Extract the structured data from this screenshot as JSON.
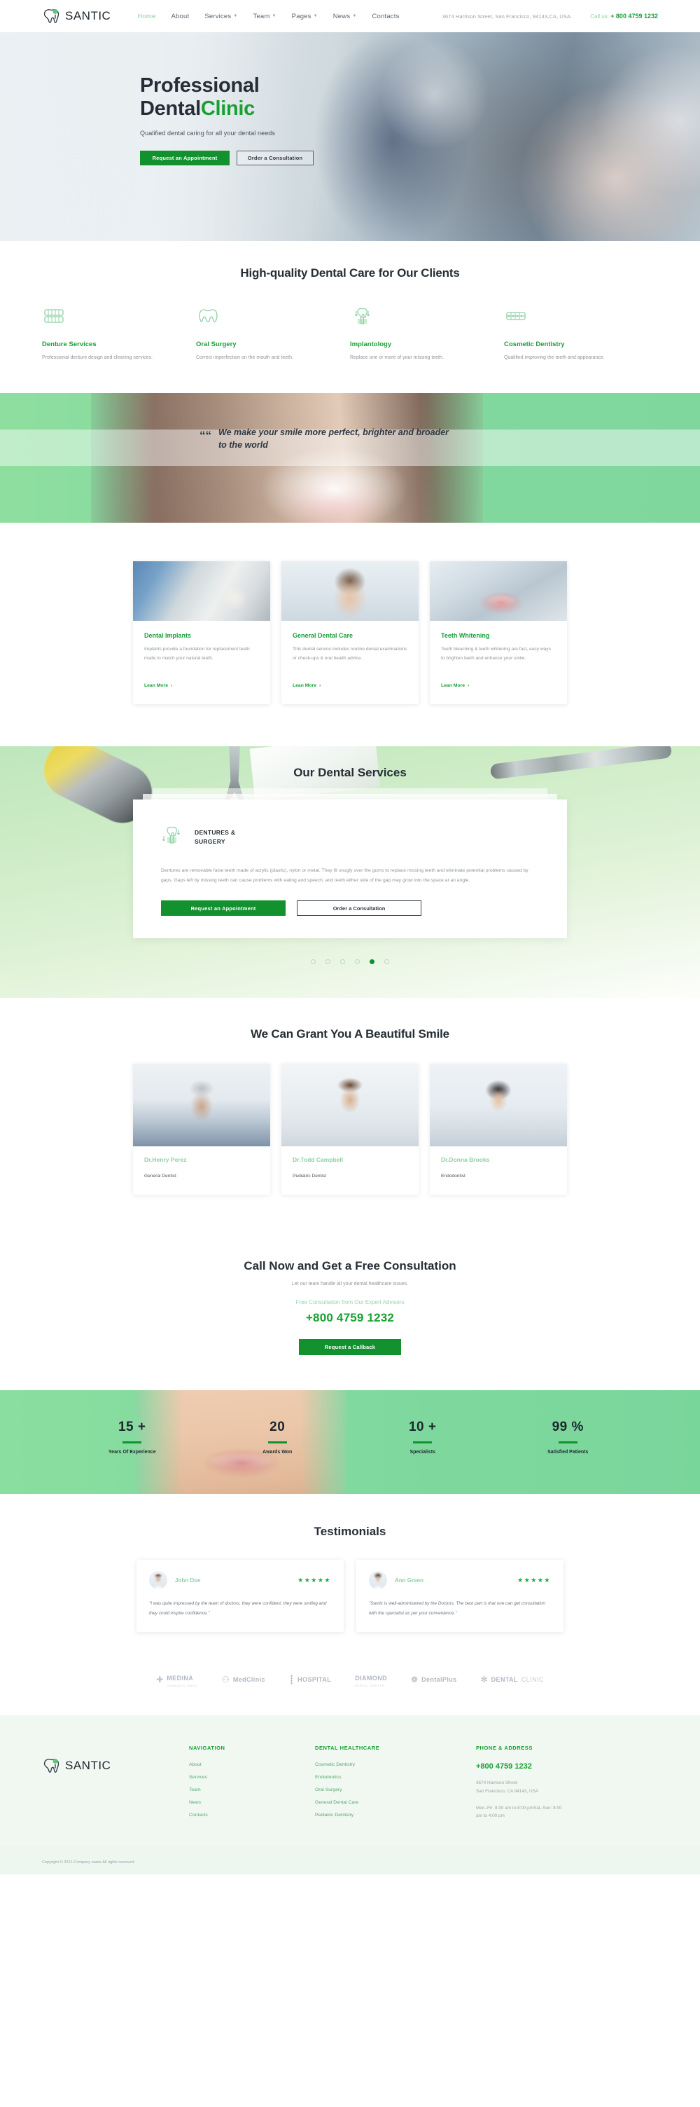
{
  "header": {
    "brand": "SANTIC",
    "brand_icon": "tooth-logo-icon",
    "nav": [
      {
        "label": "Home",
        "active": true,
        "caret": false
      },
      {
        "label": "About",
        "active": false,
        "caret": false
      },
      {
        "label": "Services",
        "active": false,
        "caret": true
      },
      {
        "label": "Team",
        "active": false,
        "caret": true
      },
      {
        "label": "Pages",
        "active": false,
        "caret": true
      },
      {
        "label": "News",
        "active": false,
        "caret": true
      },
      {
        "label": "Contacts",
        "active": false,
        "caret": false
      }
    ],
    "address": "3674 Harrison Street, San Francisco, 94143,CA, USA.",
    "call_label": "Call us:",
    "phone": "+ 800 4759 1232"
  },
  "hero": {
    "title_line1": "Professional",
    "title_line2_dark": "Dental",
    "title_line2_green": "Clinic",
    "subtitle": "Qualified dental caring for all your dental needs",
    "primary_btn": "Request an Appointment",
    "secondary_btn": "Order a Consultation"
  },
  "features": {
    "title": "High-quality Dental Care for Our Clients",
    "items": [
      {
        "icon": "denture-icon",
        "title": "Denture Services",
        "text": "Professional denture design and cleaning services."
      },
      {
        "icon": "oral-surgery-icon",
        "title": "Oral Surgery",
        "text": "Correct imperfection on the mouth and teeth."
      },
      {
        "icon": "implant-icon",
        "title": "Implantology",
        "text": "Replace one or more of your missing teeth."
      },
      {
        "icon": "braces-icon",
        "title": "Cosmetic Dentistry",
        "text": "Qualified improving the teeth and appearance."
      }
    ]
  },
  "quote": {
    "mark": "““",
    "text": "We make your smile more perfect, brighter and broader to the world"
  },
  "cards": {
    "items": [
      {
        "image": "dental-tools-photo",
        "title": "Dental Implants",
        "text": "Implants provide a foundation for replacement teeth made to match your natural teeth.",
        "link": "Lean More"
      },
      {
        "image": "smiling-woman-photo",
        "title": "General Dental Care",
        "text": "This dental service includes routine dental examinations or check-ups & oral health advice.",
        "link": "Lean More"
      },
      {
        "image": "teeth-closeup-photo",
        "title": "Teeth Whitening",
        "text": "Teeth bleaching & teeth whitening are fast, easy ways to brighten teeth and enhance your smile.",
        "link": "Lean More"
      }
    ],
    "link_arrow": "›"
  },
  "services": {
    "title": "Our Dental Services",
    "panel_icon": "implant-icon",
    "panel_title_line1": "DENTURES &",
    "panel_title_line2": "SURGERY",
    "panel_text": "Dentures are removable false teeth made of acrylic (plastic), nylon or metal. They fit snugly over the gums to replace missing teeth and eliminate potential problems caused by gaps. Gaps left by missing teeth can cause problems with eating and speech, and teeth either side of the gap may grow into the space at an angle.",
    "primary_btn": "Request an Appointment",
    "secondary_btn": "Order a Consultation",
    "dots_total": 6,
    "dot_active_index": 4
  },
  "team": {
    "title": "We Can Grant You A Beautiful Smile",
    "members": [
      {
        "photo": "male-dentist-photo",
        "name": "Dr.Henry Perez",
        "role": "General Dentist"
      },
      {
        "photo": "young-male-dentist-photo",
        "name": "Dr.Todd Campbell",
        "role": "Pediatric Dentist"
      },
      {
        "photo": "female-dentist-photo",
        "name": "Dr.Donna Brooks",
        "role": "Endodontist"
      }
    ]
  },
  "callnow": {
    "title": "Call Now and Get a Free Consultation",
    "lead": "Let our team handle all your dental healthcare issues.",
    "free_label": "Free Consultation from Our Expert Advisors",
    "phone": "+800 4759 1232",
    "button": "Request a Callback"
  },
  "stats": {
    "items": [
      {
        "value": "15 +",
        "label": "Years Of Experience"
      },
      {
        "value": "20",
        "label": "Awards Won"
      },
      {
        "value": "10 +",
        "label": "Specialists"
      },
      {
        "value": "99 %",
        "label": "Satisfied Patients"
      }
    ]
  },
  "testimonials": {
    "title": "Testimonials",
    "items": [
      {
        "avatar": "john-doe-avatar",
        "name": "John Doe",
        "stars": "★★★★★",
        "quote": "\"I was quite impressed by the team of doctors, they were confident, they were smiling and they could inspire confidence.\""
      },
      {
        "avatar": "ann-green-avatar",
        "name": "Ann Green",
        "stars": "★★★★★",
        "quote": "\"Santic is well-administered by the Doctors. The best part is that one can get consultation with the specialist as per your convenience.\""
      }
    ]
  },
  "brands": [
    {
      "mark": "✚",
      "name": "MEDINA",
      "sub": "Diagnostic center",
      "light": false
    },
    {
      "mark": "⚇",
      "name": "MedClinic",
      "sub": "",
      "light": false
    },
    {
      "mark": "┋",
      "name": "HOSPITAL",
      "sub": "",
      "light": false
    },
    {
      "mark": "",
      "name": "DIAMOND",
      "sub": "DENTAL CENTER",
      "light": false
    },
    {
      "mark": "❁",
      "name": "DentalPlus",
      "sub": "",
      "light": false
    },
    {
      "mark": "✻",
      "name": "DENTAL",
      "name2": "CLINIC",
      "sub": "",
      "light": false
    }
  ],
  "footer": {
    "brand": "SANTIC",
    "nav_title": "NAVIGATION",
    "nav_links": [
      "About",
      "Services",
      "Team",
      "News",
      "Contacts"
    ],
    "health_title": "DENTAL HEALTHCARE",
    "health_links": [
      "Cosmetic Dentistry",
      "Endodontics",
      "Oral Surgery",
      "General Dental Care",
      "Pediatric Dentistry"
    ],
    "contact_title": "PHONE & ADDRESS",
    "phone": "+800 4759 1232",
    "address_line1": "3674 Harrison Street",
    "address_line2": "San Francisco, CA 94143, USA",
    "hours_line1": "Mon–Fri: 8:00 am to 8:00 pmSat–Sun: 8:00",
    "hours_line2": "am to 4:00 pm",
    "copyright": "Copyright © 2021.Company name.All rights reserved."
  }
}
